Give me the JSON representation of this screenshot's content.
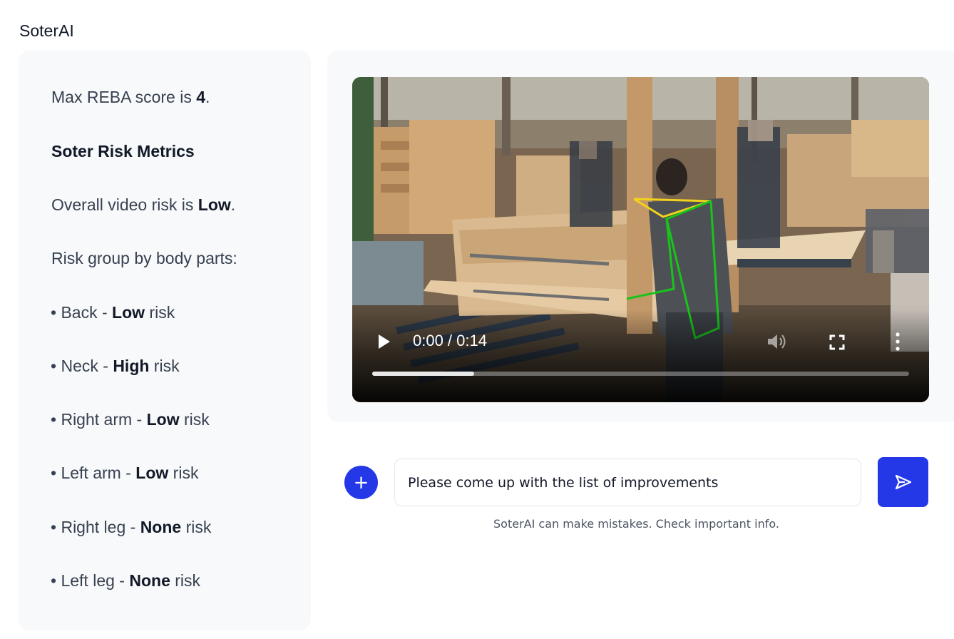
{
  "app": {
    "title": "SoterAI"
  },
  "summary": {
    "reba_prefix": "Max REBA score is ",
    "reba_score": "4",
    "reba_suffix": ".",
    "metrics_heading": "Soter Risk Metrics",
    "overall_prefix": "Overall video risk is ",
    "overall_level": "Low",
    "overall_suffix": ".",
    "body_parts_heading": "Risk group by body parts:",
    "risk_word": " risk",
    "body_parts": [
      {
        "bullet": "• ",
        "name": "Back",
        "separator": " - ",
        "level": "Low"
      },
      {
        "bullet": "• ",
        "name": "Neck",
        "separator": " - ",
        "level": "High"
      },
      {
        "bullet": "• ",
        "name": "Right arm",
        "separator": " - ",
        "level": "Low"
      },
      {
        "bullet": "• ",
        "name": "Left arm",
        "separator": " - ",
        "level": "Low"
      },
      {
        "bullet": "• ",
        "name": "Right leg",
        "separator": " - ",
        "level": "None"
      },
      {
        "bullet": "• ",
        "name": "Left leg",
        "separator": " - ",
        "level": "None"
      }
    ]
  },
  "video": {
    "time_display": "0:00 / 0:14",
    "progress_buffered_fraction": 0.19,
    "play_icon": "play-icon",
    "volume_icon": "volume-icon",
    "fullscreen_icon": "fullscreen-icon",
    "more_icon": "more-vertical-icon",
    "pose_colors": {
      "neck": "#f2d21c",
      "body": "#18c41c"
    }
  },
  "chat": {
    "add_icon": "plus-icon",
    "input_value": "Please come up with the list of improvements",
    "send_icon": "send-icon",
    "disclaimer": "SoterAI can make mistakes. Check important info."
  },
  "colors": {
    "accent": "#2438e8",
    "panel_bg": "#f8f9fa"
  }
}
